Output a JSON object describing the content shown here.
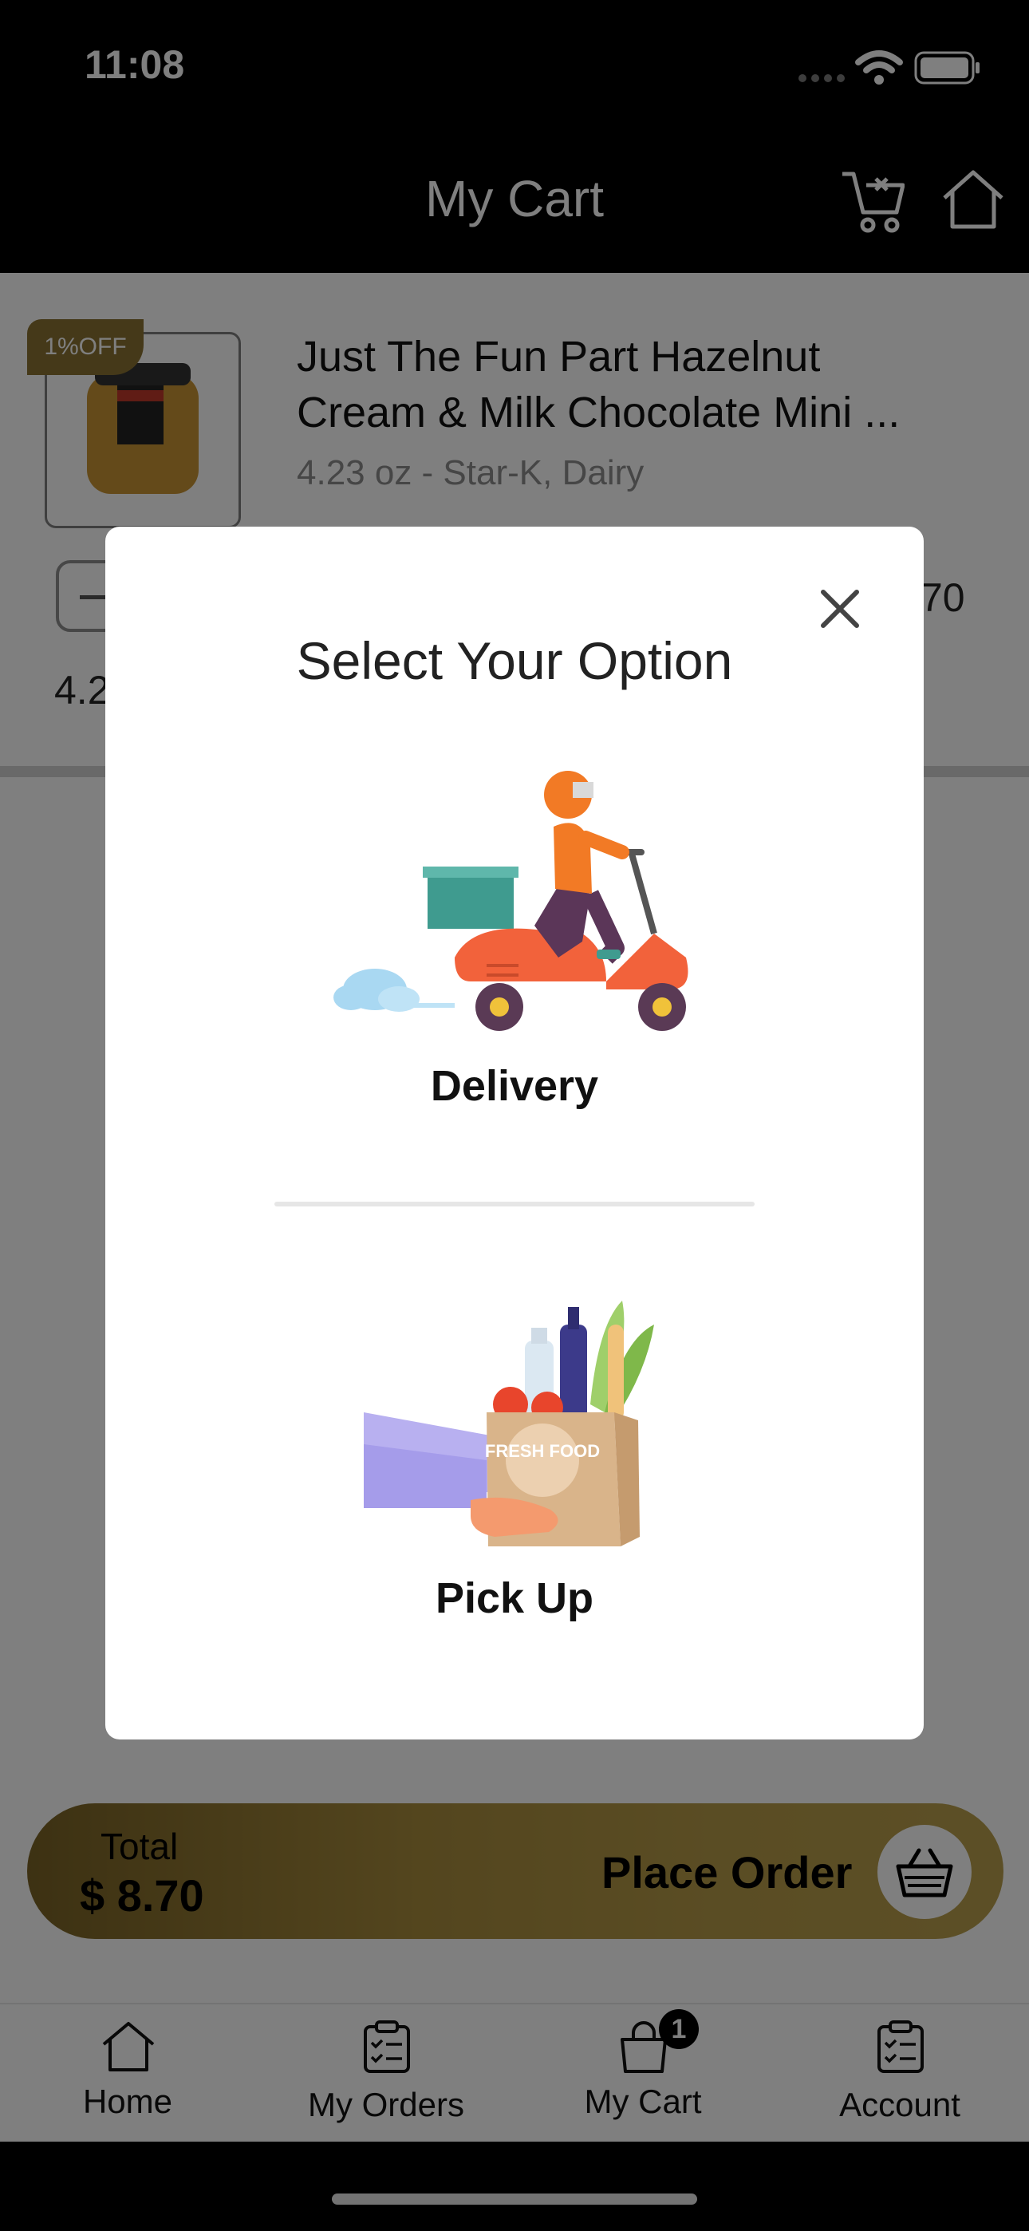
{
  "status_bar": {
    "time": "11:08"
  },
  "header": {
    "title": "My Cart",
    "icons": [
      "clear-cart-icon",
      "home-icon"
    ]
  },
  "cart_item": {
    "discount_badge": "1%OFF",
    "name_line1": "Just The Fun Part Hazelnut",
    "name_line2": "Cream & Milk Chocolate Mini ...",
    "details": "4.23 oz - Star-K, Dairy",
    "qty_unit_partial": "4.2",
    "price_partial": "70"
  },
  "total": {
    "label": "Total",
    "value": "$ 8.70",
    "place_order": "Place Order"
  },
  "tabs": [
    {
      "label": "Home",
      "icon": "home-icon"
    },
    {
      "label": "My Orders",
      "icon": "clipboard-icon"
    },
    {
      "label": "My Cart",
      "icon": "shopping-bag-icon",
      "badge": "1"
    },
    {
      "label": "Account",
      "icon": "clipboard-icon"
    }
  ],
  "modal": {
    "title": "Select Your Option",
    "options": [
      {
        "label": "Delivery",
        "illustration": "delivery-scooter-illustration"
      },
      {
        "label": "Pick Up",
        "illustration": "grocery-bag-illustration",
        "bag_text": "FRESH FOOD"
      }
    ]
  },
  "colors": {
    "accent": "#8a7233",
    "overlay": "rgba(0,0,0,0.5)"
  }
}
